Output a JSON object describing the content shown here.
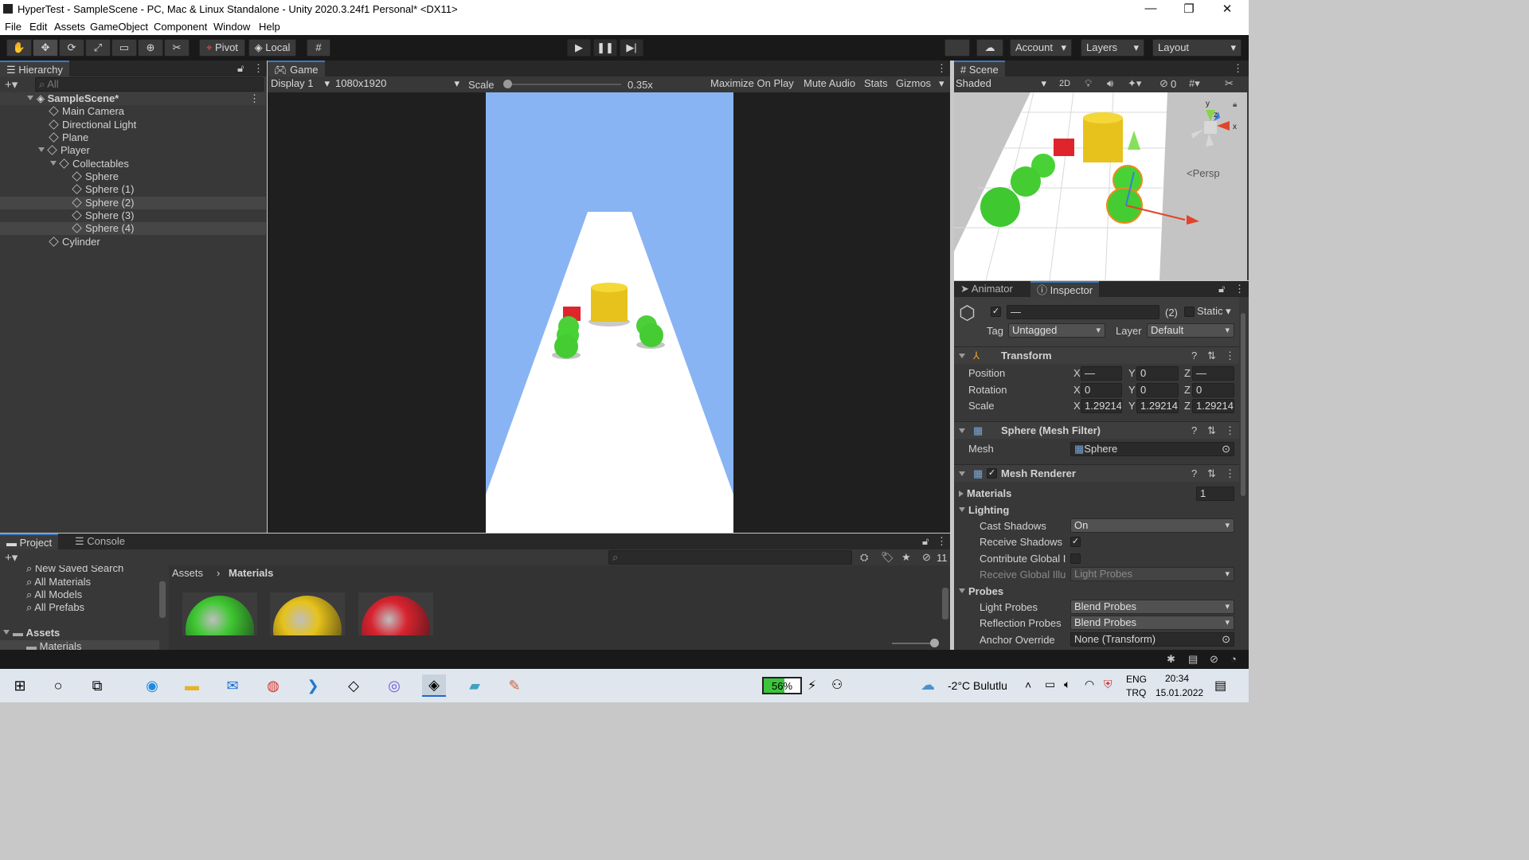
{
  "window": {
    "title": "HyperTest - SampleScene - PC, Mac & Linux Standalone - Unity 2020.3.24f1 Personal* <DX11>",
    "minimize": "—",
    "maximize": "❐",
    "close": "✕"
  },
  "menu": [
    "File",
    "Edit",
    "Assets",
    "GameObject",
    "Component",
    "Window",
    "Help"
  ],
  "toolbar": {
    "pivot_label": "Pivot",
    "local_label": "Local",
    "account_label": "Account",
    "layers_label": "Layers",
    "layout_label": "Layout"
  },
  "hierarchy": {
    "tab_label": "Hierarchy",
    "search_placeholder": "All",
    "scene_name": "SampleScene*",
    "items": [
      {
        "label": "Main Camera"
      },
      {
        "label": "Directional Light"
      },
      {
        "label": "Plane"
      },
      {
        "label": "Player"
      },
      {
        "label": "Collectables"
      },
      {
        "label": "Sphere"
      },
      {
        "label": "Sphere (1)"
      },
      {
        "label": "Sphere (2)"
      },
      {
        "label": "Sphere (3)"
      },
      {
        "label": "Sphere (4)"
      },
      {
        "label": "Cylinder"
      }
    ]
  },
  "game": {
    "tab_label": "Game",
    "display": "Display 1",
    "resolution": "1080x1920",
    "scale_label": "Scale",
    "scale_value": "0.35x",
    "scale_fraction": 0.0,
    "maximize_on_play": "Maximize On Play",
    "mute_audio": "Mute Audio",
    "stats": "Stats",
    "gizmos": "Gizmos"
  },
  "scene": {
    "tab_label": "Scene",
    "shading": "Shaded",
    "mode_2d": "2D",
    "hidden_count": "0",
    "persp_label": "<Persp",
    "axis_y": "y",
    "axis_z": "z",
    "axis_x": "x"
  },
  "inspector": {
    "animator_tab": "Animator",
    "inspector_tab": "Inspector",
    "name_value": "—",
    "count_label": "(2)",
    "static_label": "Static",
    "tag_label": "Tag",
    "tag_value": "Untagged",
    "layer_label": "Layer",
    "layer_value": "Default",
    "transform": {
      "title": "Transform",
      "position_label": "Position",
      "rotation_label": "Rotation",
      "scale_label": "Scale",
      "position": {
        "x": "—",
        "y": "0",
        "z": "—"
      },
      "rotation": {
        "x": "0",
        "y": "0",
        "z": "0"
      },
      "scale": {
        "x": "1.29214",
        "y": "1.29214",
        "z": "1.29214"
      },
      "x": "X",
      "y": "Y",
      "z": "Z"
    },
    "mesh_filter": {
      "title": "Sphere (Mesh Filter)",
      "mesh_label": "Mesh",
      "mesh_value": "Sphere"
    },
    "mesh_renderer": {
      "title": "Mesh Renderer",
      "materials_label": "Materials",
      "materials_count": "1",
      "lighting_label": "Lighting",
      "cast_shadows_label": "Cast Shadows",
      "cast_shadows_value": "On",
      "receive_shadows_label": "Receive Shadows",
      "contribute_gi_label": "Contribute Global I",
      "receive_gi_label": "Receive Global Illu",
      "receive_gi_value": "Light Probes",
      "probes_label": "Probes",
      "light_probes_label": "Light Probes",
      "light_probes_value": "Blend Probes",
      "reflection_probes_label": "Reflection Probes",
      "reflection_probes_value": "Blend Probes",
      "anchor_override_label": "Anchor Override",
      "anchor_override_value": "None (Transform)"
    }
  },
  "project": {
    "project_tab": "Project",
    "console_tab": "Console",
    "hidden_count": "11",
    "favorites": [
      "New Saved Search",
      "All Materials",
      "All Models",
      "All Prefabs"
    ],
    "assets_label": "Assets",
    "materials_folder": "Materials",
    "breadcrumb_root": "Assets",
    "breadcrumb_child": "Materials",
    "material_colors": [
      "#3fc832",
      "#e6c21b",
      "#d8232f"
    ]
  },
  "taskbar": {
    "battery": "56%",
    "weather": "-2°C Bulutlu",
    "lang1": "ENG",
    "lang2": "TRQ",
    "time": "20:34",
    "date": "15.01.2022"
  },
  "colors": {
    "sky": "#89b4f4",
    "sphere": "#45d235",
    "cylinder": "#f0cd1f",
    "cube": "#e0242b"
  }
}
